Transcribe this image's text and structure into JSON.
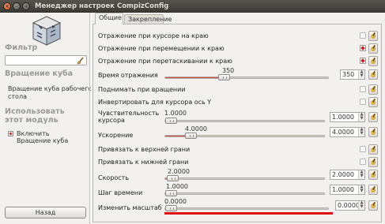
{
  "window": {
    "title": "Менеджер настроек CompizConfig",
    "controls": [
      "close",
      "minimize",
      "maximize"
    ]
  },
  "sidebar": {
    "filter_heading": "Фильтр",
    "filter_value": "",
    "plugin_heading": "Вращение куба",
    "plugin_desc_1": "Вращение куба рабочего",
    "plugin_desc_2": "стола",
    "use_heading_1": "Использовать",
    "use_heading_2": "этот модуль",
    "enable_label_1": "Включить",
    "enable_label_2": "Вращение куба",
    "enable_checked": true,
    "back_button": "Назад"
  },
  "tabs": [
    {
      "label": "Общие",
      "active": true
    },
    {
      "label": "Закрепление",
      "active": false
    }
  ],
  "settings": {
    "snap_pointer": {
      "label": "Отражение при курсоре на краю",
      "checked": false
    },
    "snap_move": {
      "label": "Отражение при перемещении к краю",
      "checked": true
    },
    "snap_drag": {
      "label": "Отражение при перетаскивании к краю",
      "checked": true
    },
    "flip_time": {
      "label": "Время отражения",
      "value": "350",
      "fraction": 0.35
    },
    "raise_on_rotate": {
      "label": "Поднимать при вращении",
      "checked": false
    },
    "invert_y": {
      "label": "Инвертировать для курсора ось Y",
      "checked": false
    },
    "sensitivity": {
      "label_1": "Чувствительность",
      "label_2": "курсора",
      "value": "1.0000",
      "fraction": 0.01
    },
    "acceleration": {
      "label": "Ускорение",
      "value": "4.0000",
      "fraction": 0.15
    },
    "snap_top": {
      "label": "Привязать к верхней грани",
      "checked": false
    },
    "snap_bottom": {
      "label": "Привязать к нижней грани",
      "checked": false
    },
    "speed": {
      "label": "Скорость",
      "value": "2.0000",
      "fraction": 0.02
    },
    "timestep": {
      "label": "Шаг времени",
      "value": "1.0000",
      "fraction": 0.01
    },
    "zoom": {
      "label": "Изменить масштаб",
      "value": "0.0000",
      "fraction": 0.0
    }
  },
  "colors": {
    "accent_red": "#e01010",
    "titlebar": "#3c3b37",
    "background": "#f2f1f0"
  }
}
